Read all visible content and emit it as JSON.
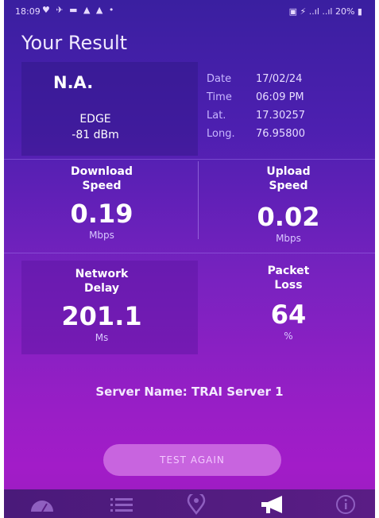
{
  "status": {
    "time": "18:09",
    "icons": "♥ ✈ ▬ ▲ ▲ •",
    "right": "▣ ⚡ ..ıl ..ıl 20% ▮"
  },
  "title": "Your Result",
  "network": {
    "operator": "N.A.",
    "type": "EDGE",
    "signal": "-81 dBm"
  },
  "info": {
    "date_label": "Date",
    "date_value": "17/02/24",
    "time_label": "Time",
    "time_value": "06:09 PM",
    "lat_label": "Lat.",
    "lat_value": "17.30257",
    "long_label": "Long.",
    "long_value": "76.95800"
  },
  "metrics": {
    "download": {
      "label_line1": "Download",
      "label_line2": "Speed",
      "value": "0.19",
      "unit": "Mbps"
    },
    "upload": {
      "label_line1": "Upload",
      "label_line2": "Speed",
      "value": "0.02",
      "unit": "Mbps"
    },
    "delay": {
      "label_line1": "Network",
      "label_line2": "Delay",
      "value": "201.1",
      "unit": "Ms"
    },
    "loss": {
      "label_line1": "Packet",
      "label_line2": "Loss",
      "value": "64",
      "unit": "%"
    }
  },
  "server": "Server Name: TRAI Server 1",
  "button": "TEST AGAIN",
  "nav": [
    "speedometer-icon",
    "list-icon",
    "location-icon",
    "megaphone-icon",
    "info-icon"
  ],
  "colors": {
    "accent": "#c864df"
  }
}
